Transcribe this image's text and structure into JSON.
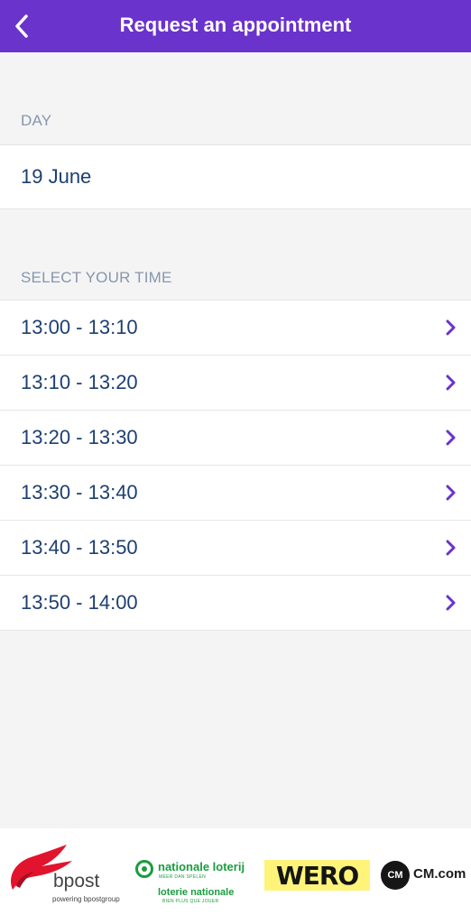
{
  "header": {
    "title": "Request an appointment",
    "back_icon": "chevron-left-icon",
    "color": "#6a33cc"
  },
  "day_section": {
    "label": "DAY",
    "value": "19 June"
  },
  "time_section": {
    "label": "SELECT YOUR TIME",
    "slots": [
      "13:00 - 13:10",
      "13:10 - 13:20",
      "13:20 - 13:30",
      "13:30 - 13:40",
      "13:40 - 13:50",
      "13:50 - 14:00"
    ],
    "chevron_icon": "chevron-right-icon",
    "accent_color": "#6a33cc",
    "text_color": "#1d3f72"
  },
  "footer": {
    "bpost": {
      "name": "bpost",
      "tagline": "powering bpostgroup"
    },
    "loterij": {
      "name_nl": "nationale loterij",
      "tagline_nl": "MEER DAN SPELEN",
      "name_fr": "loterie nationale",
      "tagline_fr": "BIEN PLUS QUE JOUER"
    },
    "wero": {
      "name": "WERO"
    },
    "cm": {
      "badge": "CM",
      "name": "CM.com"
    }
  }
}
